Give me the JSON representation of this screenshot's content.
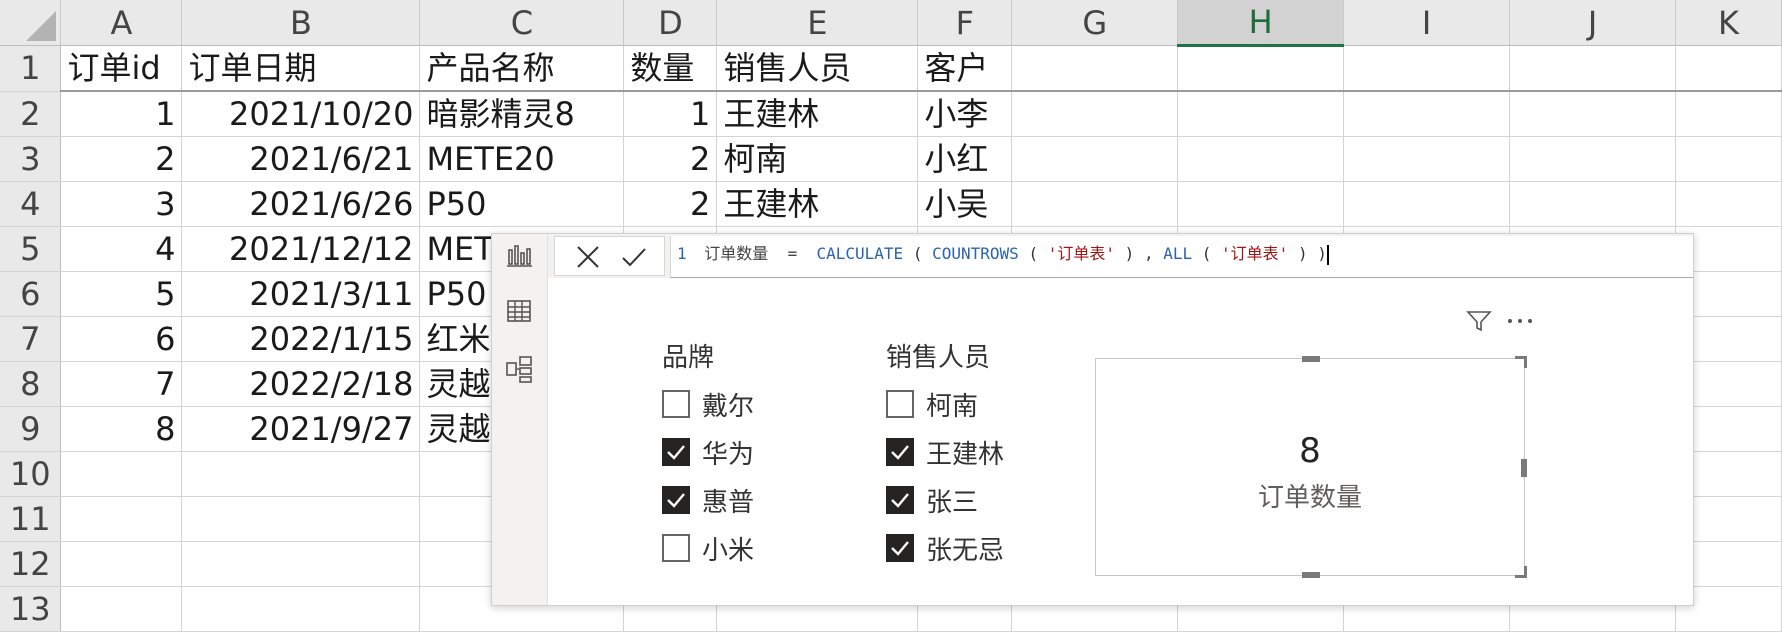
{
  "sheet": {
    "columns": [
      "A",
      "B",
      "C",
      "D",
      "E",
      "F",
      "G",
      "H",
      "I",
      "J",
      "K"
    ],
    "active_column": "H",
    "rows": [
      {
        "n": "1",
        "cells": [
          "订单id",
          "订单日期",
          "产品名称",
          "数量",
          "销售人员",
          "客户",
          "",
          "",
          "",
          "",
          ""
        ]
      },
      {
        "n": "2",
        "cells": [
          "1",
          "2021/10/20",
          "暗影精灵8",
          "1",
          "王建林",
          "小李",
          "",
          "",
          "",
          "",
          ""
        ]
      },
      {
        "n": "3",
        "cells": [
          "2",
          "2021/6/21",
          "METE20",
          "2",
          "柯南",
          "小红",
          "",
          "",
          "",
          "",
          ""
        ]
      },
      {
        "n": "4",
        "cells": [
          "3",
          "2021/6/26",
          "P50",
          "2",
          "王建林",
          "小吴",
          "",
          "",
          "",
          "",
          ""
        ]
      },
      {
        "n": "5",
        "cells": [
          "4",
          "2021/12/12",
          "MET",
          "",
          "",
          "",
          "",
          "",
          "",
          "",
          ""
        ]
      },
      {
        "n": "6",
        "cells": [
          "5",
          "2021/3/11",
          "P50",
          "",
          "",
          "",
          "",
          "",
          "",
          "",
          ""
        ]
      },
      {
        "n": "7",
        "cells": [
          "6",
          "2022/1/15",
          "红米",
          "",
          "",
          "",
          "",
          "",
          "",
          "",
          ""
        ]
      },
      {
        "n": "8",
        "cells": [
          "7",
          "2022/2/18",
          "灵越",
          "",
          "",
          "",
          "",
          "",
          "",
          "",
          ""
        ]
      },
      {
        "n": "9",
        "cells": [
          "8",
          "2021/9/27",
          "灵越",
          "",
          "",
          "",
          "",
          "",
          "",
          "",
          ""
        ]
      },
      {
        "n": "10",
        "cells": [
          "",
          "",
          "",
          "",
          "",
          "",
          "",
          "",
          "",
          "",
          ""
        ]
      },
      {
        "n": "11",
        "cells": [
          "",
          "",
          "",
          "",
          "",
          "",
          "",
          "",
          "",
          "",
          ""
        ]
      },
      {
        "n": "12",
        "cells": [
          "",
          "",
          "",
          "",
          "",
          "",
          "",
          "",
          "",
          "",
          ""
        ]
      },
      {
        "n": "13",
        "cells": [
          "",
          "",
          "",
          "",
          "",
          "",
          "",
          "",
          "",
          "",
          ""
        ]
      }
    ]
  },
  "formula": {
    "line_number": "1",
    "measure_name": "订单数量",
    "equals": " = ",
    "fn_calculate": "CALCULATE",
    "fn_countrows": "COUNTROWS",
    "arg1": "'订单表'",
    "fn_all": "ALL",
    "arg2": "'订单表'",
    "open": "(",
    "close": ")",
    "comma": ","
  },
  "slicers": [
    {
      "title": "品牌",
      "items": [
        {
          "label": "戴尔",
          "checked": false
        },
        {
          "label": "华为",
          "checked": true
        },
        {
          "label": "惠普",
          "checked": true
        },
        {
          "label": "小米",
          "checked": false
        }
      ]
    },
    {
      "title": "销售人员",
      "items": [
        {
          "label": "柯南",
          "checked": false
        },
        {
          "label": "王建林",
          "checked": true
        },
        {
          "label": "张三",
          "checked": true
        },
        {
          "label": "张无忌",
          "checked": true
        }
      ]
    }
  ],
  "card": {
    "value": "8",
    "label": "订单数量"
  },
  "icons": {
    "rail": [
      "report-view-icon",
      "table-view-icon",
      "model-view-icon"
    ],
    "formula": [
      "cancel-icon",
      "commit-icon"
    ],
    "visual": [
      "filter-icon",
      "more-options-icon"
    ]
  }
}
